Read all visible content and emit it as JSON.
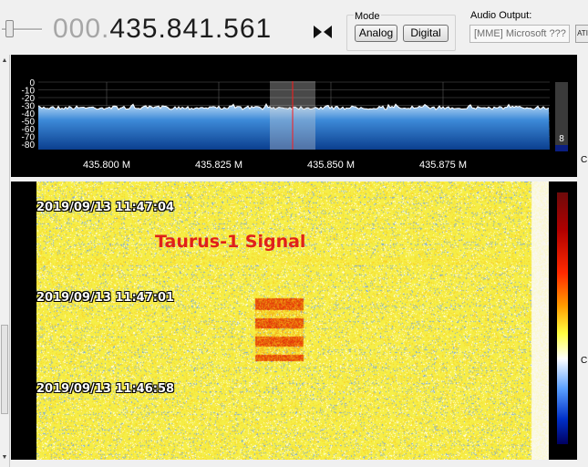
{
  "frequency": {
    "leading": "000.",
    "main": "435.841.561"
  },
  "mode": {
    "label": "Mode",
    "buttons": [
      "Analog",
      "Digital"
    ]
  },
  "audio": {
    "label": "Audio Output:",
    "device": "[MME] Microsoft ???"
  },
  "extra_button": "ATI",
  "right_edge": [
    "C",
    "C"
  ],
  "spectrum": {
    "db_ticks": [
      "0",
      "-10",
      "-20",
      "-30",
      "-40",
      "-50",
      "-60",
      "-70",
      "-80"
    ],
    "freq_ticks": [
      "435.800 M",
      "435.825 M",
      "435.850 M",
      "435.875 M"
    ],
    "side_value": "8"
  },
  "waterfall": {
    "timestamps": [
      "2019/09/13 11:47:04",
      "2019/09/13 11:47:01",
      "2019/09/13 11:46:58"
    ],
    "annotation": "Taurus-1  Signal"
  },
  "colors": {
    "accent_red": "#e0201a",
    "spectrum_blue": "#1a63b8",
    "waterfall_yellow": "#f6ef45"
  }
}
